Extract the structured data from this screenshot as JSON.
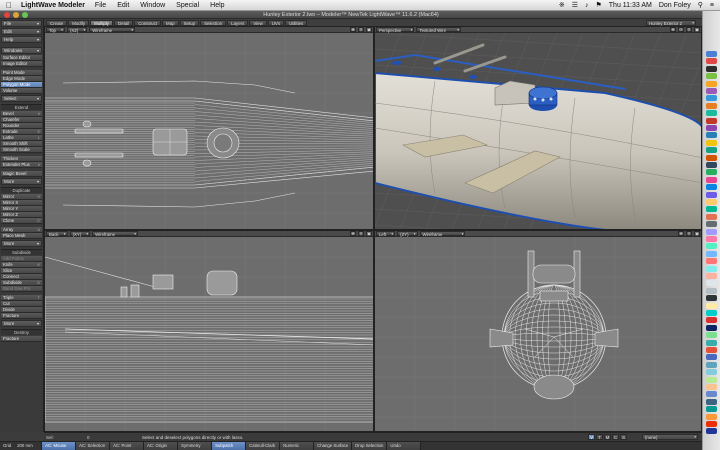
{
  "menubar": {
    "app": "LightWave Modeler",
    "menus": [
      "File",
      "Edit",
      "Window",
      "Special",
      "Help"
    ],
    "clock": "Thu 11:33 AM",
    "user": "Don Foley"
  },
  "window": {
    "title": "Hunley Exterior 2.lwo – Modeler™ NewTek LightWave™ 11.6.2 (Mac64)"
  },
  "toolbar": {
    "dropdowns": [
      "File",
      "Edit",
      "Help"
    ],
    "windows_dd": "Windows",
    "editors": [
      "Surface Editor",
      "Image Editor"
    ],
    "modes": [
      "Point Mode",
      "Edge Mode",
      "Polygon Mode",
      "Volume"
    ],
    "selected_mode": "Polygon Mode",
    "select_dd": "Select",
    "extend_head": "Extend",
    "extend": [
      {
        "label": "Bevel",
        "hk": "b"
      },
      {
        "label": "Chamfer",
        "hk": ""
      },
      {
        "label": "Rounder",
        "hk": ""
      },
      {
        "label": "Extrude",
        "hk": "E"
      },
      {
        "label": "Lathe",
        "hk": "L"
      },
      {
        "label": "Smooth Shift",
        "hk": ""
      },
      {
        "label": "Smooth Scale",
        "hk": ""
      }
    ],
    "extend2": [
      {
        "label": "Thicken",
        "hk": ""
      },
      {
        "label": "Extender Plus",
        "hk": "e"
      }
    ],
    "magic_bevel": "Magic Bevel",
    "more1": "More",
    "duplicate_head": "Duplicate",
    "duplicate": [
      {
        "label": "Mirror",
        "hk": "V"
      },
      {
        "label": "Mirror X",
        "hk": ""
      },
      {
        "label": "Mirror Y",
        "hk": ""
      },
      {
        "label": "Mirror Z",
        "hk": ""
      },
      {
        "label": "Clone",
        "hk": "C"
      }
    ],
    "duplicate2": [
      {
        "label": "Array",
        "hk": "A"
      },
      {
        "label": "Place Mesh",
        "hk": ""
      }
    ],
    "more2": "More",
    "subdivide_head": "Subdivide",
    "subdivide": [
      {
        "label": "Add Points",
        "hk": "",
        "disabled": true
      },
      {
        "label": "Knife",
        "hk": "K"
      },
      {
        "label": "Slice",
        "hk": ""
      },
      {
        "label": "Connect",
        "hk": ""
      },
      {
        "label": "Subdivide",
        "hk": "D"
      },
      {
        "label": "Band Saw Pro",
        "hk": "",
        "disabled": true
      }
    ],
    "subdivide2": [
      {
        "label": "Triple",
        "hk": "T"
      },
      {
        "label": "Cut",
        "hk": ""
      },
      {
        "label": "Divide",
        "hk": ""
      },
      {
        "label": "Fracture",
        "hk": ""
      }
    ],
    "more3": "More",
    "destroy_head": "Destroy",
    "destroy": [
      {
        "label": "Fracture",
        "hk": ""
      }
    ]
  },
  "tabs": [
    "Create",
    "Modify",
    "Multiply",
    "Detail",
    "Construct",
    "Map",
    "Setup",
    "Selection",
    "Layers",
    "View",
    "UVs",
    "Utilities"
  ],
  "active_tab": "Multiply",
  "layer_dd": "Hunley Exterior 2",
  "viewports": {
    "tl": {
      "view": "Top",
      "axis": "(XZ)",
      "mode": "Wireframe"
    },
    "tr": {
      "view": "Perspective",
      "mode": "Textured Wire"
    },
    "bl": {
      "view": "Back",
      "axis": "(XY)",
      "mode": "Wireframe"
    },
    "br": {
      "view": "Left",
      "axis": "(ZY)",
      "mode": "Wireframe"
    }
  },
  "status": {
    "sel_label": "Sel:",
    "sel_count": "0",
    "hint": "Select and deselect polygons directly or with lasso.",
    "view_tools": [
      "V",
      "T",
      "M",
      "C",
      "S"
    ],
    "mode": "(none)"
  },
  "bottombar": {
    "grid_label": "Grid",
    "grid_value": "200 mm",
    "items": [
      "AC: Mouse",
      "AC: Selection",
      "AC: Point",
      "AC: Origin",
      "Symmetry",
      "Subpatch",
      "Catmull-Clark",
      "Numeric",
      "Change Surface",
      "Drop Selection",
      "Undo"
    ],
    "active": [
      "AC: Mouse",
      "Subpatch"
    ]
  },
  "colors": {
    "viewport_bg": "#6d6d6d",
    "wire": "#dcdcdc",
    "selection_blue": "#6b8fc7",
    "perspective_blue": "#1e4fb0"
  }
}
